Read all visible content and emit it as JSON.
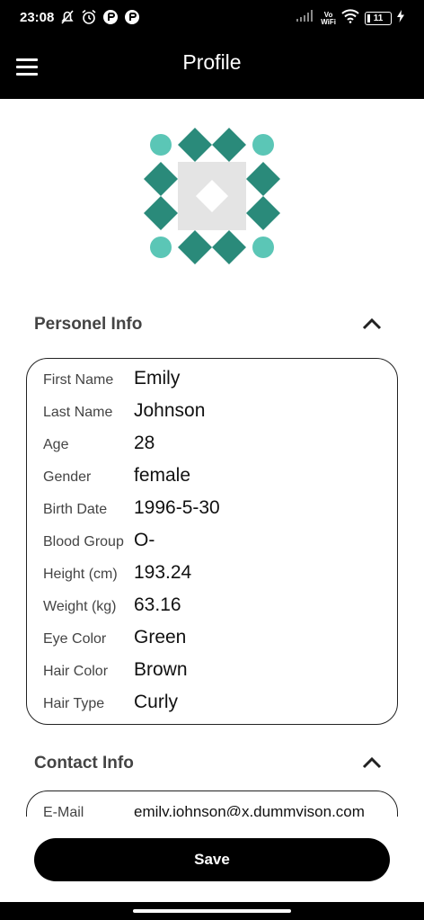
{
  "status_bar": {
    "time": "23:08",
    "left_icons": [
      "muted-notification-icon",
      "alarm-icon",
      "app-badge-icon",
      "app-badge-icon"
    ],
    "vowifi_line1": "Vo",
    "vowifi_line2": "WiFi",
    "battery_level": "11",
    "charging": true
  },
  "app_bar": {
    "title": "Profile",
    "menu_icon": "hamburger-menu-icon"
  },
  "avatar": {
    "colors": {
      "diamond": "#2a8a7a",
      "circle": "#5bc6b6",
      "center": "#e4e4e4"
    }
  },
  "personal_info": {
    "title": "Personel Info",
    "expanded": true,
    "rows": [
      {
        "label": "First Name",
        "value": "Emily"
      },
      {
        "label": "Last Name",
        "value": "Johnson"
      },
      {
        "label": "Age",
        "value": "28"
      },
      {
        "label": "Gender",
        "value": "female"
      },
      {
        "label": "Birth Date",
        "value": "1996-5-30"
      },
      {
        "label": "Blood Group",
        "value": "O-"
      },
      {
        "label": "Height (cm)",
        "value": "193.24"
      },
      {
        "label": "Weight (kg)",
        "value": "63.16"
      },
      {
        "label": "Eye Color",
        "value": "Green"
      },
      {
        "label": "Hair Color",
        "value": "Brown"
      },
      {
        "label": "Hair Type",
        "value": "Curly"
      }
    ]
  },
  "contact_info": {
    "title": "Contact Info",
    "expanded": true,
    "rows": [
      {
        "label": "E-Mail",
        "value": "emily.johnson@x.dummyjson.com"
      }
    ]
  },
  "save_label": "Save"
}
